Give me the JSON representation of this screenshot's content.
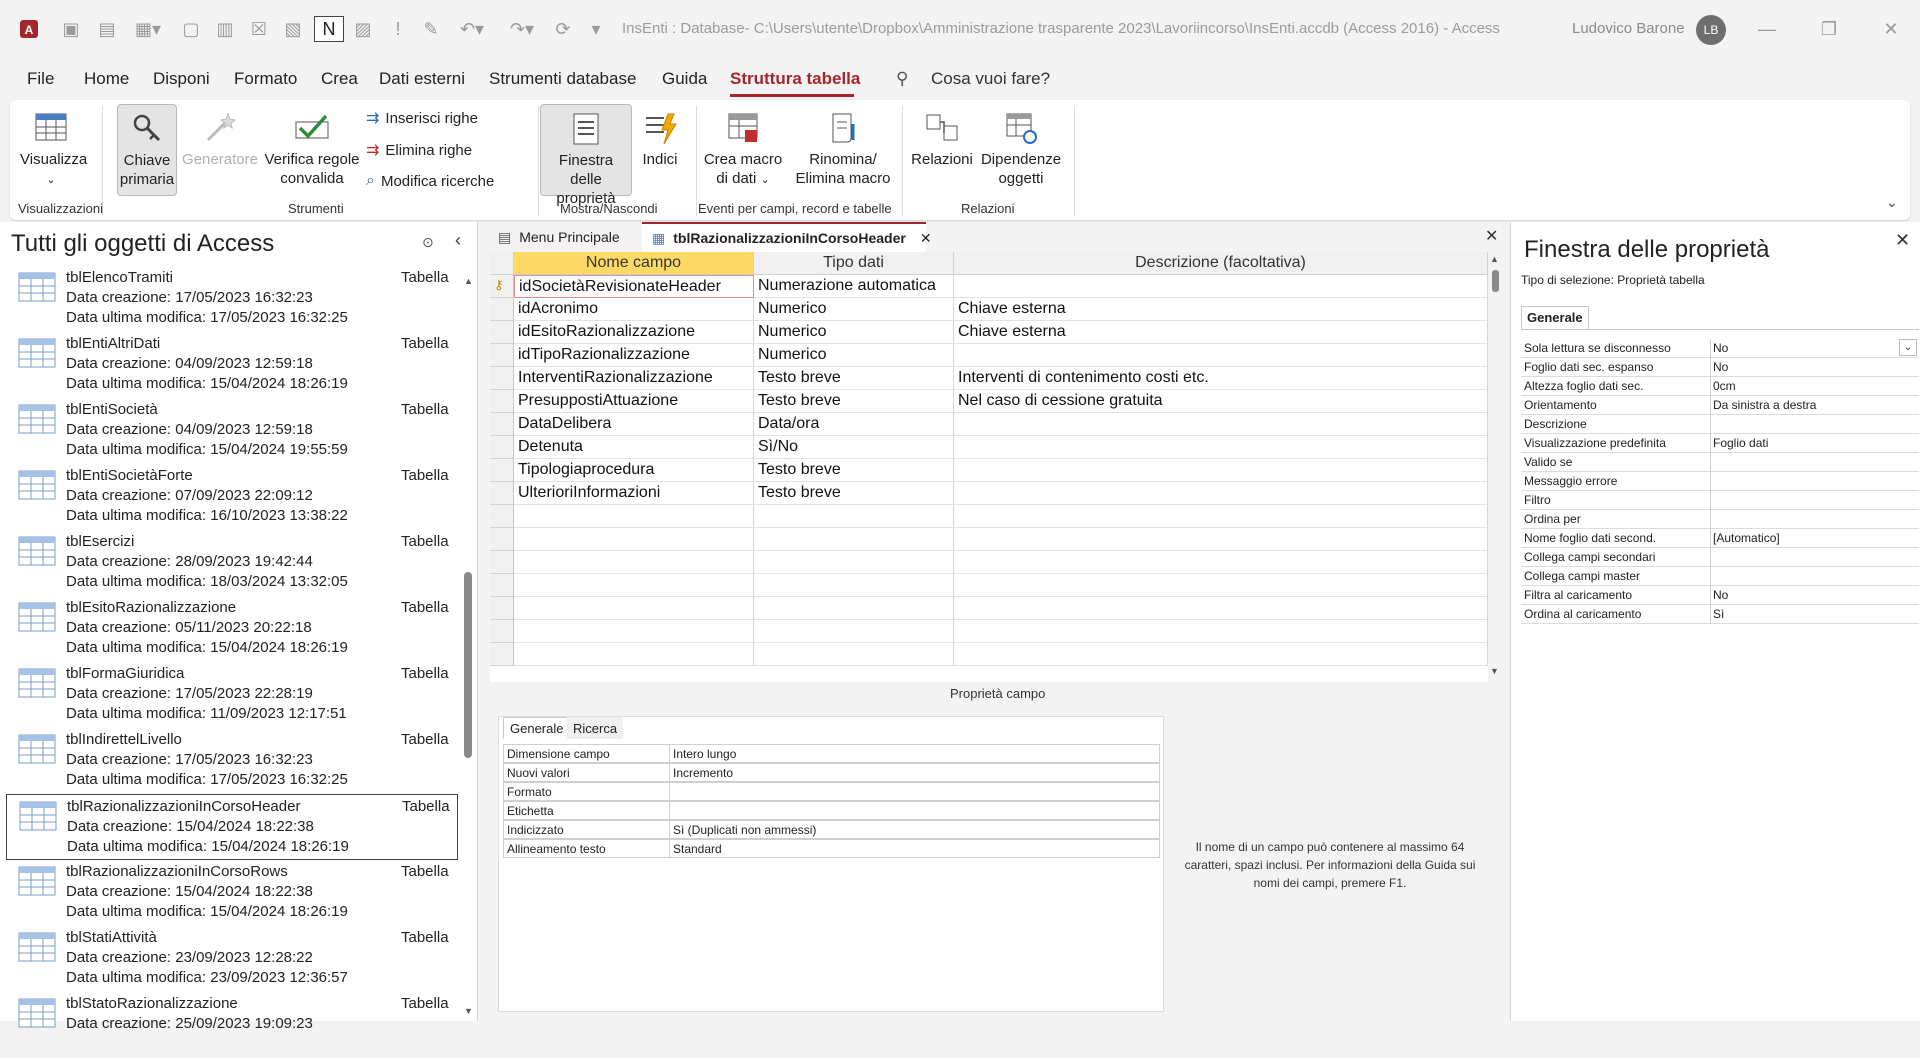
{
  "window": {
    "title": "InsEnti : Database- C:\\Users\\utente\\Dropbox\\Amministrazione trasparente 2023\\Lavoriincorso\\InsEnti.accdb (Access 2016)  -  Access",
    "user_name": "Ludovico Barone",
    "user_initials": "LB"
  },
  "menu": [
    "File",
    "Home",
    "Disponi",
    "Formato",
    "Crea",
    "Dati esterni",
    "Strumenti database",
    "Guida",
    "Struttura tabella"
  ],
  "menu_active": "Struttura tabella",
  "search_placeholder": "Cosa vuoi fare?",
  "ribbon": {
    "visualizza": "Visualizza",
    "chiave_1": "Chiave",
    "chiave_2": "primaria",
    "generatore": "Generatore",
    "verifica_1": "Verifica regole",
    "verifica_2": "convalida",
    "inserisci": "Inserisci righe",
    "elimina": "Elimina righe",
    "modifica": "Modifica ricerche",
    "finestra_1": "Finestra delle",
    "finestra_2": "proprietà",
    "indici": "Indici",
    "crea_macro_1": "Crea macro",
    "crea_macro_2": "di dati",
    "rinomina_1": "Rinomina/",
    "rinomina_2": "Elimina macro",
    "relazioni": "Relazioni",
    "dipendenze_1": "Dipendenze",
    "dipendenze_2": "oggetti",
    "groups": [
      "Visualizzazioni",
      "Strumenti",
      "Mostra/Nascondi",
      "Eventi per campi, record e tabelle",
      "Relazioni"
    ]
  },
  "nav": {
    "title": "Tutti gli oggetti di Access",
    "items": [
      {
        "name": "tblElencoTramiti",
        "type": "Tabella",
        "created": "Data creazione: 17/05/2023 16:32:23",
        "modified": "Data ultima modifica: 17/05/2023 16:32:25"
      },
      {
        "name": "tblEntiAltriDati",
        "type": "Tabella",
        "created": "Data creazione: 04/09/2023 12:59:18",
        "modified": "Data ultima modifica: 15/04/2024 18:26:19"
      },
      {
        "name": "tblEntiSocietà",
        "type": "Tabella",
        "created": "Data creazione: 04/09/2023 12:59:18",
        "modified": "Data ultima modifica: 15/04/2024 19:55:59"
      },
      {
        "name": "tblEntiSocietàForte",
        "type": "Tabella",
        "created": "Data creazione: 07/09/2023 22:09:12",
        "modified": "Data ultima modifica: 16/10/2023 13:38:22"
      },
      {
        "name": "tblEsercizi",
        "type": "Tabella",
        "created": "Data creazione: 28/09/2023 19:42:44",
        "modified": "Data ultima modifica: 18/03/2024 13:32:05"
      },
      {
        "name": "tblEsitoRazionalizzazione",
        "type": "Tabella",
        "created": "Data creazione: 05/11/2023 20:22:18",
        "modified": "Data ultima modifica: 15/04/2024 18:26:19"
      },
      {
        "name": "tblFormaGiuridica",
        "type": "Tabella",
        "created": "Data creazione: 17/05/2023 22:28:19",
        "modified": "Data ultima modifica: 11/09/2023 12:17:51"
      },
      {
        "name": "tblIndirettelLivello",
        "type": "Tabella",
        "created": "Data creazione: 17/05/2023 16:32:23",
        "modified": "Data ultima modifica: 17/05/2023 16:32:25"
      },
      {
        "name": "tblRazionalizzazioniInCorsoHeader",
        "type": "Tabella",
        "created": "Data creazione: 15/04/2024 18:22:38",
        "modified": "Data ultima modifica: 15/04/2024 18:26:19"
      },
      {
        "name": "tblRazionalizzazioniInCorsoRows",
        "type": "Tabella",
        "created": "Data creazione: 15/04/2024 18:22:38",
        "modified": "Data ultima modifica: 15/04/2024 18:26:19"
      },
      {
        "name": "tblStatiAttività",
        "type": "Tabella",
        "created": "Data creazione: 23/09/2023 12:28:22",
        "modified": "Data ultima modifica: 23/09/2023 12:36:57"
      },
      {
        "name": "tblStatoRazionalizzazione",
        "type": "Tabella",
        "created": "Data creazione: 25/09/2023 19:09:23",
        "modified": ""
      }
    ]
  },
  "tabs": [
    "Menu Principale",
    "tblRazionalizzazioniInCorsoHeader"
  ],
  "grid": {
    "headers": [
      "Nome campo",
      "Tipo dati",
      "Descrizione (facoltativa)"
    ],
    "rows": [
      {
        "name": "idSocietàRevisionateHeader",
        "type": "Numerazione automatica",
        "desc": ""
      },
      {
        "name": "idAcronimo",
        "type": "Numerico",
        "desc": "Chiave esterna"
      },
      {
        "name": "idEsitoRazionalizzazione",
        "type": "Numerico",
        "desc": "Chiave esterna"
      },
      {
        "name": "idTipoRazionalizzazione",
        "type": "Numerico",
        "desc": ""
      },
      {
        "name": "InterventiRazionalizzazione",
        "type": "Testo breve",
        "desc": "Interventi di contenimento costi etc."
      },
      {
        "name": "PresuppostiAttuazione",
        "type": "Testo breve",
        "desc": "Nel caso di cessione gratuita"
      },
      {
        "name": "DataDelibera",
        "type": "Data/ora",
        "desc": ""
      },
      {
        "name": "Detenuta",
        "type": "Sì/No",
        "desc": ""
      },
      {
        "name": "Tipologiaprocedura",
        "type": "Testo breve",
        "desc": ""
      },
      {
        "name": "UlterioriInformazioni",
        "type": "Testo breve",
        "desc": ""
      }
    ]
  },
  "field_props": {
    "label": "Proprietà campo",
    "tabs": [
      "Generale",
      "Ricerca"
    ],
    "rows": [
      {
        "k": "Dimensione campo",
        "v": "Intero lungo"
      },
      {
        "k": "Nuovi valori",
        "v": "Incremento"
      },
      {
        "k": "Formato",
        "v": ""
      },
      {
        "k": "Etichetta",
        "v": ""
      },
      {
        "k": "Indicizzato",
        "v": "Sì (Duplicati non ammessi)"
      },
      {
        "k": "Allineamento testo",
        "v": "Standard"
      }
    ],
    "hint": "Il nome di un campo può contenere al massimo 64 caratteri, spazi inclusi. Per informazioni della Guida sui nomi dei campi, premere F1."
  },
  "property_sheet": {
    "title": "Finestra delle proprietà",
    "selection": "Tipo di selezione:  Proprietà tabella",
    "tab": "Generale",
    "rows": [
      {
        "k": "Sola lettura se disconnesso",
        "v": "No"
      },
      {
        "k": "Foglio dati sec. espanso",
        "v": "No"
      },
      {
        "k": "Altezza foglio dati sec.",
        "v": "0cm"
      },
      {
        "k": "Orientamento",
        "v": "Da sinistra a destra"
      },
      {
        "k": "Descrizione",
        "v": ""
      },
      {
        "k": "Visualizzazione predefinita",
        "v": "Foglio dati"
      },
      {
        "k": "Valido se",
        "v": ""
      },
      {
        "k": "Messaggio errore",
        "v": ""
      },
      {
        "k": "Filtro",
        "v": ""
      },
      {
        "k": "Ordina per",
        "v": ""
      },
      {
        "k": "Nome foglio dati second.",
        "v": "[Automatico]"
      },
      {
        "k": "Collega campi secondari",
        "v": ""
      },
      {
        "k": "Collega campi master",
        "v": ""
      },
      {
        "k": "Filtra al caricamento",
        "v": "No"
      },
      {
        "k": "Ordina al caricamento",
        "v": "Sì"
      }
    ]
  },
  "colors": {
    "accent": "#a4262c",
    "key_yellow": "#ffe08a",
    "header_yellow": "#ffd966"
  }
}
